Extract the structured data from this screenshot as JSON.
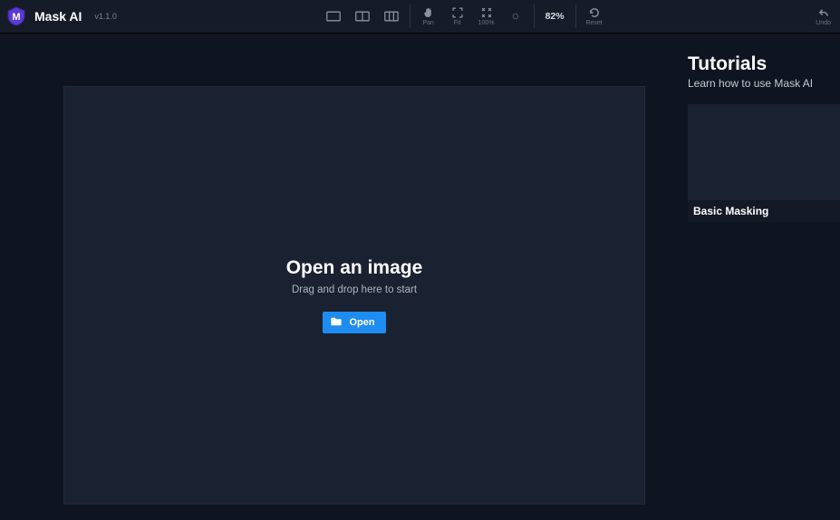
{
  "header": {
    "app_name": "Mask AI",
    "version": "v1.1.0",
    "zoom": "82%",
    "btn_pan": "Pan",
    "btn_fit": "Fit",
    "btn_100": "100%",
    "btn_reset": "Reset",
    "btn_undo": "Undo"
  },
  "canvas": {
    "title": "Open an image",
    "subtitle": "Drag and drop here to start",
    "open_label": "Open"
  },
  "sidebar": {
    "title": "Tutorials",
    "subtitle": "Learn how to use Mask AI",
    "tutorials": [
      {
        "caption": "Basic Masking"
      }
    ]
  }
}
